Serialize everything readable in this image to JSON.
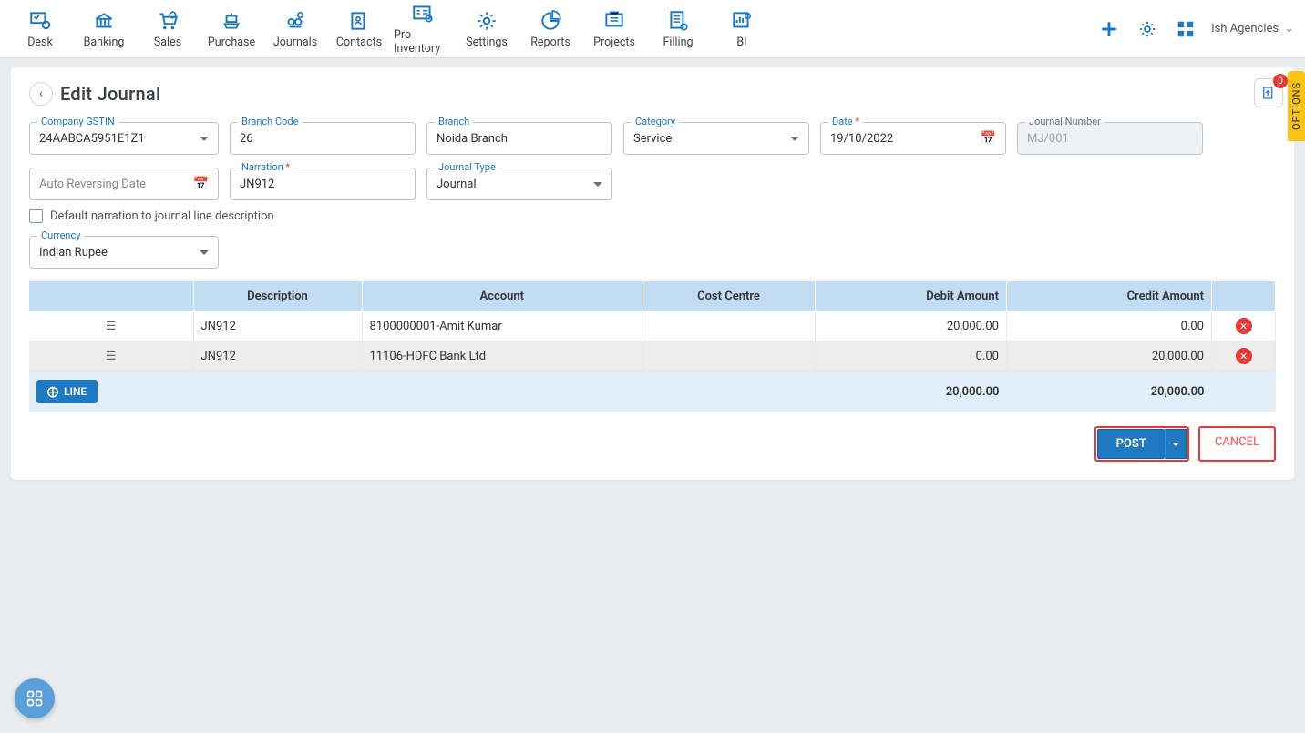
{
  "topnav": {
    "items": [
      {
        "label": "Desk"
      },
      {
        "label": "Banking"
      },
      {
        "label": "Sales"
      },
      {
        "label": "Purchase"
      },
      {
        "label": "Journals"
      },
      {
        "label": "Contacts"
      },
      {
        "label": "Pro Inventory"
      },
      {
        "label": "Settings"
      },
      {
        "label": "Reports"
      },
      {
        "label": "Projects"
      },
      {
        "label": "Filling"
      },
      {
        "label": "BI"
      }
    ],
    "company": "ish Agencies"
  },
  "page": {
    "title": "Edit Journal",
    "upload_badge": "0",
    "options_label": "OPTIONS"
  },
  "form": {
    "company_gstin": {
      "label": "Company GSTIN",
      "value": "24AABCA5951E1Z1"
    },
    "branch_code": {
      "label": "Branch Code",
      "value": "26"
    },
    "branch": {
      "label": "Branch",
      "value": "Noida Branch"
    },
    "category": {
      "label": "Category",
      "value": "Service"
    },
    "date": {
      "label": "Date",
      "value": "19/10/2022",
      "required": true
    },
    "journal_number": {
      "label": "Journal Number",
      "value": "MJ/001"
    },
    "auto_rev": {
      "placeholder": "Auto Reversing Date"
    },
    "narration": {
      "label": "Narration",
      "value": "JN912",
      "required": true
    },
    "journal_type": {
      "label": "Journal Type",
      "value": "Journal"
    },
    "default_narration_checkbox": "Default narration to journal line description",
    "currency": {
      "label": "Currency",
      "value": "Indian Rupee"
    }
  },
  "table": {
    "headers": {
      "description": "Description",
      "account": "Account",
      "cost_centre": "Cost Centre",
      "debit": "Debit Amount",
      "credit": "Credit Amount"
    },
    "rows": [
      {
        "description": "JN912",
        "account": "8100000001-Amit Kumar",
        "cost_centre": "",
        "debit": "20,000.00",
        "credit": "0.00"
      },
      {
        "description": "JN912",
        "account": "11106-HDFC Bank Ltd",
        "cost_centre": "",
        "debit": "0.00",
        "credit": "20,000.00"
      }
    ],
    "add_line": "LINE",
    "total_debit": "20,000.00",
    "total_credit": "20,000.00"
  },
  "actions": {
    "post": "POST",
    "cancel": "CANCEL"
  }
}
